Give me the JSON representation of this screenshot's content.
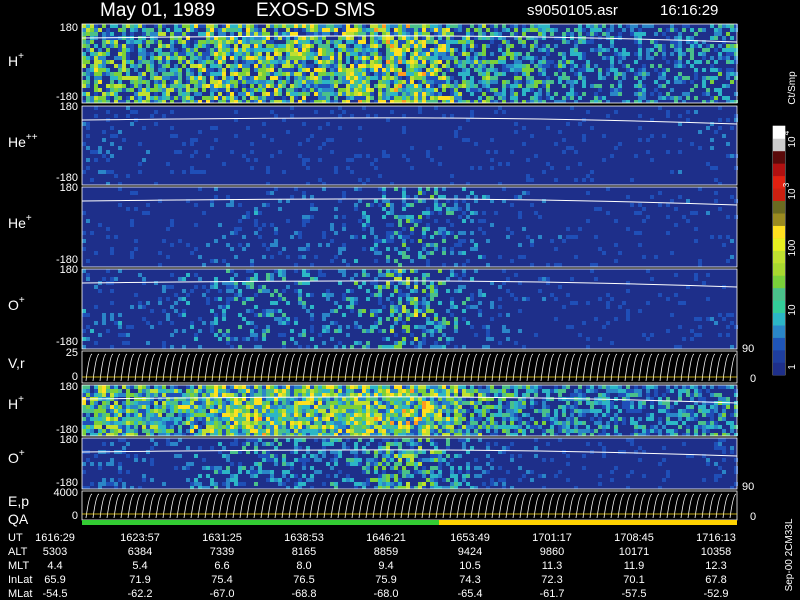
{
  "header": {
    "date": "May 01, 1989",
    "instrument": "EXOS-D SMS",
    "file": "s9050105.asr",
    "time": "16:16:29"
  },
  "colorbar": {
    "unit": "Ct/Smp",
    "tick_labels": [
      "1",
      "10",
      "100",
      "10",
      "3",
      "10",
      "4"
    ]
  },
  "panels": [
    {
      "id": "h-plus-1",
      "label": "H",
      "charge": "+",
      "ymax": "180",
      "ymin": "-180"
    },
    {
      "id": "he-plus-plus",
      "label": "He",
      "charge": "++",
      "ymax": "180",
      "ymin": "-180"
    },
    {
      "id": "he-plus",
      "label": "He",
      "charge": "+",
      "ymax": "180",
      "ymin": "-180"
    },
    {
      "id": "o-plus-1",
      "label": "O",
      "charge": "+",
      "ymax": "180",
      "ymin": "-180"
    },
    {
      "id": "v-r",
      "label": "V,r",
      "charge": "",
      "ymax": "25",
      "ymin": "0",
      "rmax": "90",
      "rmin": "0"
    },
    {
      "id": "h-plus-2",
      "label": "H",
      "charge": "+",
      "ymax": "180",
      "ymin": "-180"
    },
    {
      "id": "o-plus-2",
      "label": "O",
      "charge": "+",
      "ymax": "180",
      "ymin": "-180"
    },
    {
      "id": "e-p",
      "label": "E,p",
      "charge": "",
      "ymax": "4000",
      "ymin": "0",
      "rmax": "90",
      "rmin": "0"
    },
    {
      "id": "qa",
      "label": "QA",
      "charge": "",
      "ymax": "",
      "ymin": ""
    }
  ],
  "table": {
    "row_labels": [
      "UT",
      "ALT",
      "MLT",
      "InLat",
      "MLat"
    ],
    "columns": [
      [
        "1616:29",
        "5303",
        "4.4",
        "65.9",
        "-54.5"
      ],
      [
        "1623:57",
        "6384",
        "5.4",
        "71.9",
        "-62.2"
      ],
      [
        "1631:25",
        "7339",
        "6.6",
        "75.4",
        "-67.0"
      ],
      [
        "1638:53",
        "8165",
        "8.0",
        "76.5",
        "-68.8"
      ],
      [
        "1646:21",
        "8859",
        "9.4",
        "75.9",
        "-68.0"
      ],
      [
        "1653:49",
        "9424",
        "10.5",
        "74.3",
        "-65.4"
      ],
      [
        "1701:17",
        "9860",
        "11.3",
        "72.3",
        "-61.7"
      ],
      [
        "1708:45",
        "10171",
        "11.9",
        "70.1",
        "-57.5"
      ],
      [
        "1716:13",
        "10358",
        "12.3",
        "67.8",
        "-52.9"
      ]
    ]
  },
  "footer_note": "Sep-00 2CM33L",
  "colors": {
    "background": "#000000",
    "spectrogram_base": "#1e2f8a",
    "qa_good": "#33cc33",
    "qa_flag": "#ffd200"
  },
  "chart_data": {
    "type": "heatmap",
    "x": [
      "1616:29",
      "1623:57",
      "1631:25",
      "1638:53",
      "1646:21",
      "1653:49",
      "1701:17",
      "1708:45",
      "1716:13"
    ],
    "y_unit": "pitch angle (deg)",
    "colorscale_unit": "Ct/Smp",
    "colorscale_range": [
      1,
      10000
    ],
    "colorscale_log": true,
    "series": [
      {
        "name": "H+",
        "intensity_profile": [
          0.7,
          0.65,
          0.8,
          0.75,
          0.85,
          0.55,
          0.45,
          0.4,
          0.5
        ]
      },
      {
        "name": "He++",
        "intensity_profile": [
          0.2,
          0.1,
          0.1,
          0.1,
          0.1,
          0.1,
          0.1,
          0.1,
          0.15
        ]
      },
      {
        "name": "He+",
        "intensity_profile": [
          0.15,
          0.1,
          0.25,
          0.2,
          0.55,
          0.2,
          0.1,
          0.1,
          0.15
        ]
      },
      {
        "name": "O+",
        "intensity_profile": [
          0.25,
          0.2,
          0.45,
          0.35,
          0.7,
          0.2,
          0.1,
          0.1,
          0.15
        ]
      }
    ]
  }
}
